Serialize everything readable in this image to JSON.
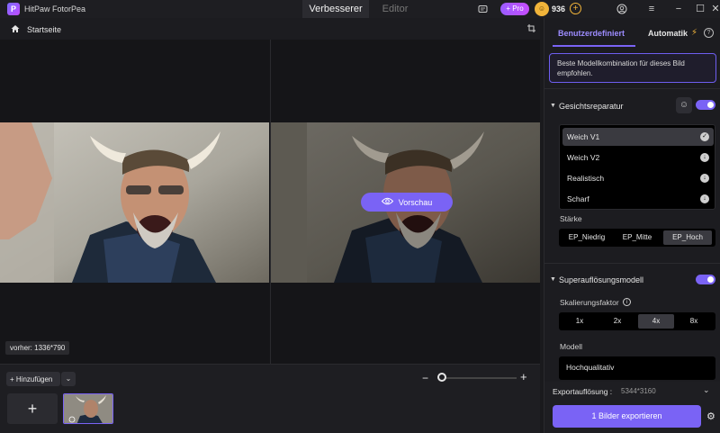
{
  "app": {
    "title": "HitPaw FotorPea",
    "logo_letter": "P"
  },
  "tabs": {
    "active": "Verbesserer",
    "inactive": "Editor"
  },
  "titlebar": {
    "pro_label": "+ Pro",
    "coin_count": "936",
    "coin_add": "+"
  },
  "breadcrumb": {
    "label": "Startseite"
  },
  "canvas": {
    "preview_label": "Vorschau",
    "before_label": "vorher: 1336*790"
  },
  "bottom": {
    "add_label": "+ Hinzufügen",
    "add_dropdown": "⌄",
    "zoom_minus": "−",
    "zoom_plus": "+",
    "zoom_level": 0.0,
    "add_tile": "+"
  },
  "panel": {
    "tab_custom": "Benutzerdefiniert",
    "tab_auto": "Automatik",
    "hint": "Beste Modellkombination für dieses Bild empfohlen.",
    "face": {
      "title": "Gesichtsreparatur",
      "enabled": true,
      "models": [
        {
          "label": "Weich V1",
          "state": "selected"
        },
        {
          "label": "Weich V2",
          "state": "download"
        },
        {
          "label": "Realistisch",
          "state": "download"
        },
        {
          "label": "Scharf",
          "state": "download"
        }
      ],
      "strength_label": "Stärke",
      "strength_options": [
        "EP_Niedrig",
        "EP_Mitte",
        "EP_Hoch"
      ],
      "strength_selected": "EP_Hoch"
    },
    "super": {
      "title": "Superauflösungsmodell",
      "enabled": true,
      "scale_label": "Skalierungsfaktor",
      "scale_options": [
        "1x",
        "2x",
        "4x",
        "8x"
      ],
      "scale_selected": "4x",
      "model_label": "Modell",
      "model_value": "Hochqualitativ"
    },
    "export": {
      "label": "Exportauflösung :",
      "resolution": "5344*3160",
      "button": "1 Bilder exportieren"
    }
  },
  "colors": {
    "accent": "#7a63f5",
    "background": "#1a1a1d",
    "coin": "#f1b43a"
  }
}
